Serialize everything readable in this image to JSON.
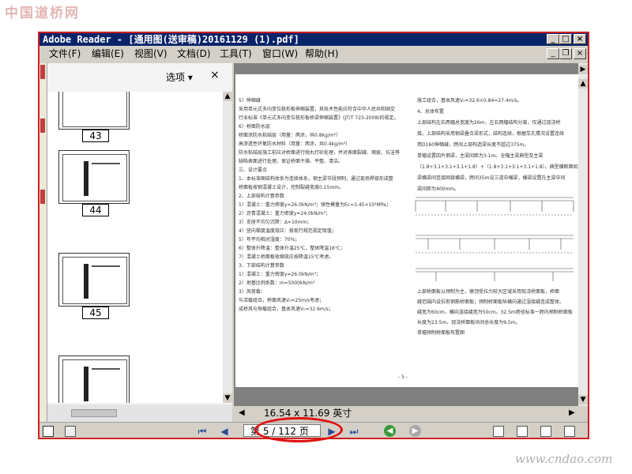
{
  "watermark_top": "中国道桥网",
  "watermark_bottom": "www.cndao.com",
  "window": {
    "title": "Adobe Reader - [通用图(送审稿)20161129 (1).pdf]",
    "min": "_",
    "max": "□",
    "close": "×"
  },
  "menu": [
    "文件(F)",
    "编辑(E)",
    "视图(V)",
    "文档(D)",
    "工具(T)",
    "窗口(W)",
    "帮助(H)"
  ],
  "sidebar": {
    "options_label": "选项 ▾",
    "close": "×",
    "thumbnails": [
      "43",
      "44",
      "45"
    ]
  },
  "document": {
    "left_column": [
      "5）伸缩缝",
      "采用单元式多向变位梳形板伸缩装置，其技术性能应符合中华人民共和国交",
      "行业标准《单元式多向变位梳形板桥梁伸缩装置》(JT/T 723-2008)的规定。",
      "6）桥面防水层",
      "桥面涂防水粘结层（用量：两涂，共0.8kg/m²）",
      "高渗透性环氧防水材料（用量：两涂，共0.4kg/m²）",
      "防水粘结层施工前应对桥面进行抛丸打砂处理，并对表面裂缝、瑕疵、坑洼等",
      "缺陷表面进行处理，保证桥面干燥、平整、清洁。",
      "三、设计要点",
      "1、本标准图结构体系为连续体系，钢主梁节段预制，通过现场焊接形成整",
      "桥面板按钢混凝土设计，控制裂缝宽度0.15mm。",
      "2、上部结构计算参数",
      "1）混凝土：重力密度γ=26.0kN/m³；弹性模量为Ec=3.45×10⁴MPa；",
      "2）沥青混凝土：重力密度γ=24.0kN/m³；",
      "3）支座不均匀沉降：Δ=10mm；",
      "4）竖向梯度温度效应：按现行规范规定取值；",
      "5）年平均相对湿度：70%；",
      "6）整体升降温：整体升温25℃，整体降温16℃；",
      "7）混凝土桥面板收缩效应按降温15℃考虑。",
      "3、下部结构计算参数",
      "1）混凝土：重力密度γ=26.0kN/m³；",
      "2）地基比例系数：m=5000kN/m⁴",
      "3）风荷载：",
      "与活载组合，桥面风速V₀=25m/s考虑；",
      "成桥风与恒载组合，基本风速V₀=32.6m/s；"
    ],
    "right_column": [
      "施工组合，基本风速V₀=32.6×0.84=27.4m/s。",
      "4、总体布置",
      "上部结构左右两幅总宽度为26m，左右两幅结构分离，仅通过现浇桥",
      "接。上部结构采用钢梁叠合梁形式，结构连续，根据车孔情况设置连续",
      "用D160伸缩缝，跨间上部构造梁长度不超过375m。",
      "单幅设置四片钢梁，主梁间距为3.1m。全幅主梁典型及主梁",
      "（1.8+3.1+3.1+3.1+1.8）+（1.8+3.1+3.1+3.1+1.8）。典型横断面如下，",
      "梁横梁间连接固接横梁，跨间35m设三道中横梁，横梁设置在主梁中间",
      "梁间距为400mm。",
      "上部桥面板以预制为主，墩顶受拉力较大区域采用现浇桥面板，桥面",
      "缝范围内设抗剪钢筋桥面板；预制桥面板纵横向通过湿接缝连成整体。",
      "缝宽为60cm，横向湿接缝宽为50cm。32.5m跨径标准一跨内预制桥面板",
      "长度为23.5m，现浇桥面板块间总长度为9.5m。",
      "单幅预制桥面板布置图"
    ],
    "page_number": "- 5 -"
  },
  "status": {
    "page_size": "16.54 x 11.69 英寸"
  },
  "bottom": {
    "page_box": "第 5 / 112 页"
  }
}
